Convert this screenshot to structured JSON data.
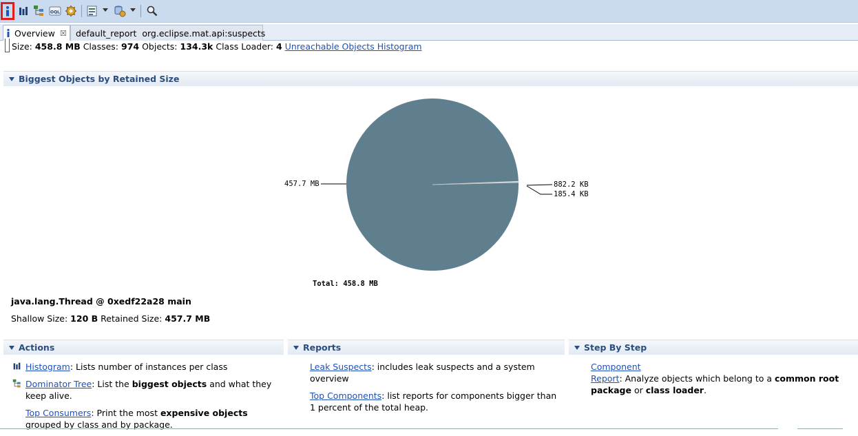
{
  "toolbar": {
    "icons": [
      "info-icon",
      "histogram-icon",
      "dominator-tree-icon",
      "oql-icon",
      "heap-dump-overview-icon",
      "query-browser-icon",
      "find-leaks-icon",
      "search-icon"
    ]
  },
  "tabs": [
    {
      "label": "Overview",
      "close": "☒"
    },
    {
      "label": "default_report  org.eclipse.mat.api:suspects"
    }
  ],
  "summary": {
    "size_label": "Size:",
    "size_value": "458.8 MB",
    "classes_label": "Classes:",
    "classes_value": "974",
    "objects_label": "Objects:",
    "objects_value": "134.3k",
    "loader_label": "Class Loader:",
    "loader_value": "4",
    "link": "Unreachable Objects Histogram"
  },
  "biggest": {
    "title": "Biggest Objects by Retained Size"
  },
  "chart_data": {
    "type": "pie",
    "labels": [
      "457.7 MB",
      "882.2 KB",
      "185.4 KB"
    ],
    "values": [
      457.7,
      0.8615,
      0.1811
    ],
    "colors": [
      "#5f7f8e",
      "#e0e0e0",
      "#c0c0c0"
    ],
    "total": "Total: 458.8 MB"
  },
  "object": {
    "title": "java.lang.Thread @ 0xedf22a28 main",
    "shallow_label": "Shallow Size:",
    "shallow_value": "120 B",
    "retained_label": "Retained Size:",
    "retained_value": "457.7 MB"
  },
  "actions": {
    "title": "Actions",
    "histogram": {
      "link": "Histogram",
      "text": ": Lists number of instances per class"
    },
    "dominator": {
      "link": "Dominator Tree",
      "text1": ": List the ",
      "bold": "biggest objects",
      "text2": " and what they keep alive."
    },
    "consumers": {
      "link": "Top Consumers",
      "text1": ": Print the most ",
      "bold": "expensive objects",
      "text2": " grouped by class and by package."
    }
  },
  "reports": {
    "title": "Reports",
    "leak": {
      "link": "Leak Suspects",
      "text": ": includes leak suspects and a system overview"
    },
    "components": {
      "link": "Top Components",
      "text": ": list reports for components bigger than 1 percent of the total heap."
    }
  },
  "step": {
    "title": "Step By Step",
    "component": {
      "link": "Component Report",
      "text1": ": Analyze objects which belong to a ",
      "bold1": "common root package",
      "text2": " or ",
      "bold2": "class loader",
      "text3": "."
    }
  }
}
